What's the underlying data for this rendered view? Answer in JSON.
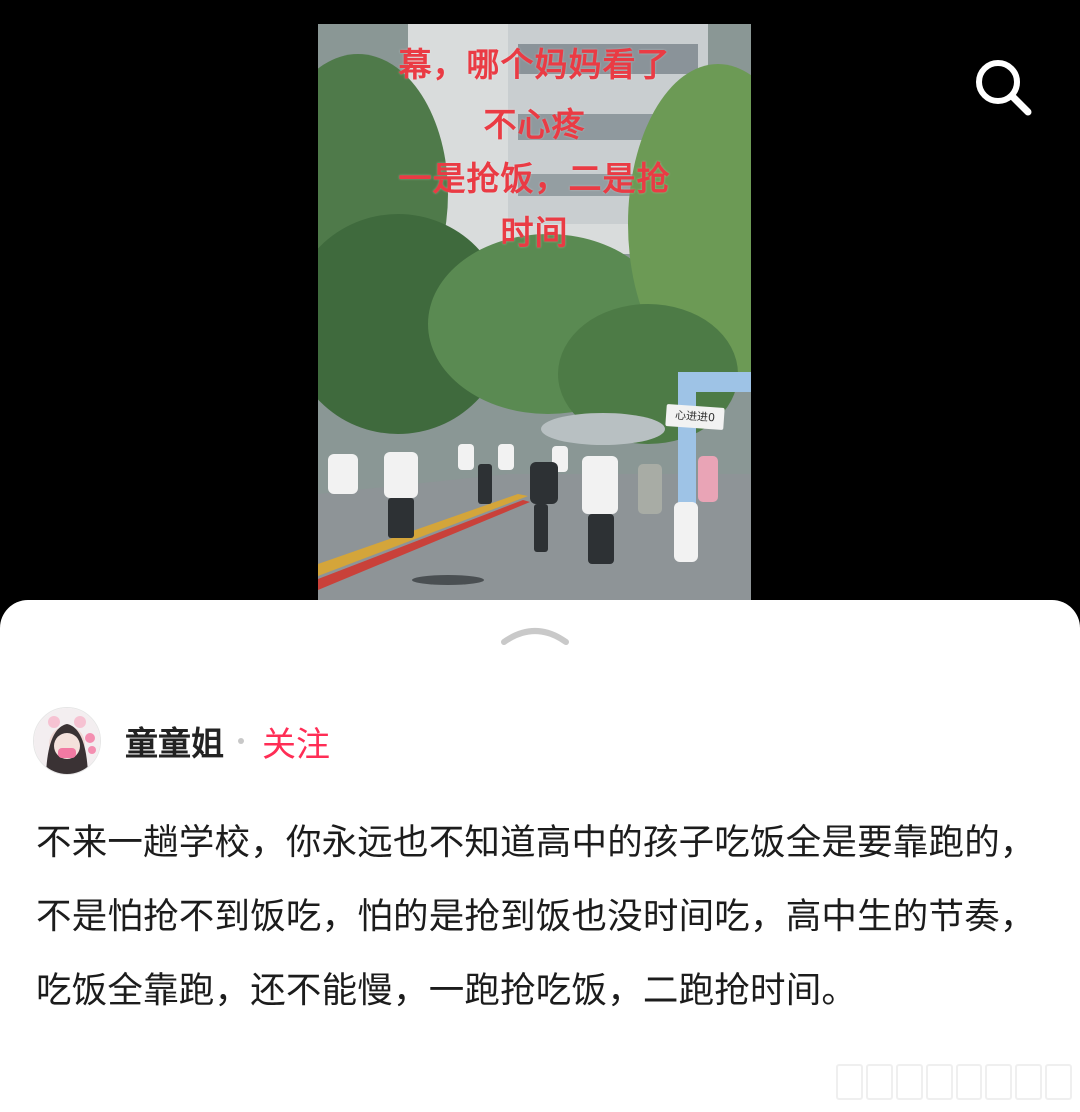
{
  "video": {
    "overlay_lines": [
      "幕，哪个妈妈看了",
      "不心疼",
      "一是抢饭，二是抢",
      "时间"
    ],
    "sign_text": "心进进0"
  },
  "post": {
    "author_name": "童童姐",
    "follow_label": "关注",
    "text": "不来一趟学校，你永远也不知道高中的孩子吃饭全是要靠跑的，不是怕抢不到饭吃，怕的是抢到饭也没时间吃，高中生的节奏，吃饭全靠跑，还不能慢，一跑抢吃饭，二跑抢时间。"
  },
  "colors": {
    "accent": "#ff2d55",
    "overlay_text": "#ea3b44",
    "background": "#000000",
    "sheet": "#ffffff"
  },
  "icons": {
    "search": "search-icon",
    "expand": "chevron-up-icon"
  }
}
